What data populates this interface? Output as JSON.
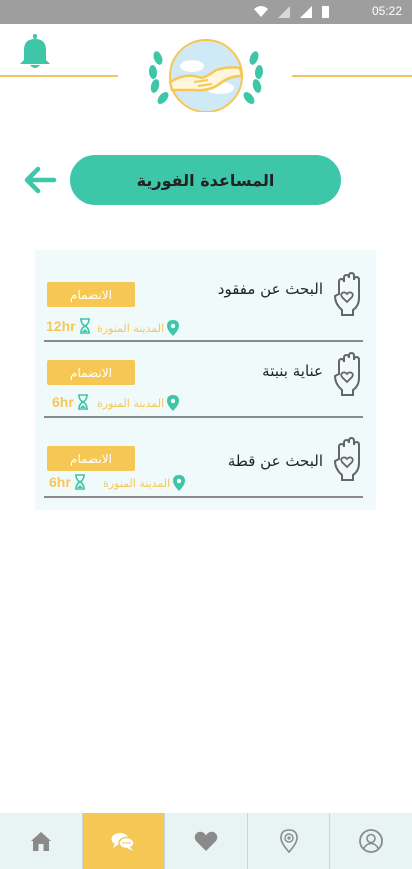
{
  "status_bar": {
    "time": "05:22"
  },
  "header": {
    "title": "المساعدة الفورية"
  },
  "items": [
    {
      "name": "البحث عن مفقود",
      "join_label": "الانضمام",
      "city": "المدينة المنورة",
      "duration": "12hr"
    },
    {
      "name": "عناية بنبتة",
      "join_label": "الانضمام",
      "city": "المدينة المنورة",
      "duration": "6hr"
    },
    {
      "name": "البحث عن قطة",
      "join_label": "الانضمام",
      "city": "المدينة المنورة",
      "duration": "6hr"
    }
  ],
  "nav": {
    "tabs": [
      {
        "icon": "home-icon",
        "active": false
      },
      {
        "icon": "chat-icon",
        "active": true
      },
      {
        "icon": "heart-icon",
        "active": false
      },
      {
        "icon": "location-icon",
        "active": false
      },
      {
        "icon": "profile-icon",
        "active": false
      }
    ]
  },
  "colors": {
    "teal": "#3ec6a8",
    "yellow": "#f5c754",
    "nav_bg": "#e8f3f3",
    "list_bg": "#f1fafb"
  }
}
